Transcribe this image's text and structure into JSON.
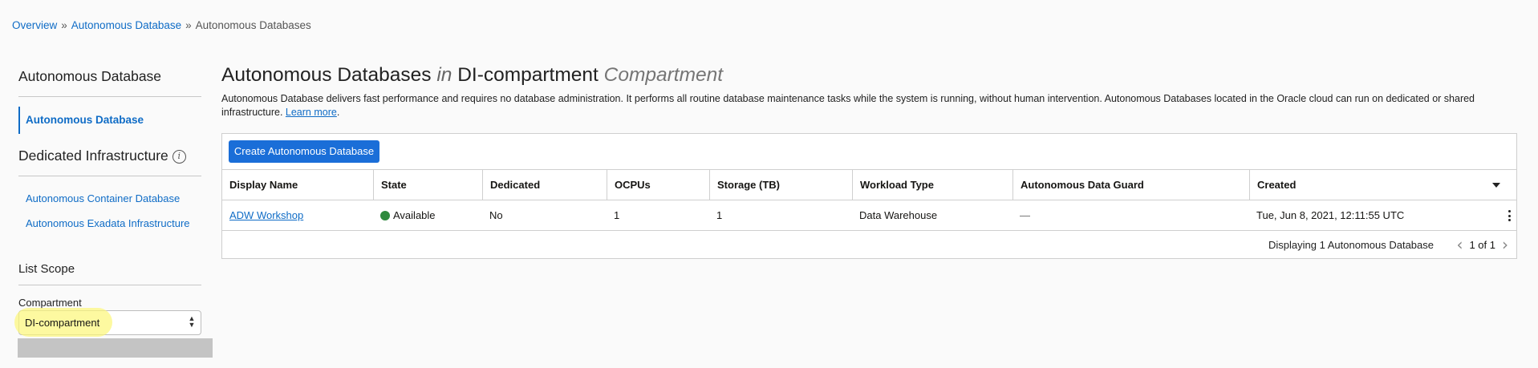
{
  "breadcrumb": {
    "items": [
      "Overview",
      "Autonomous Database",
      "Autonomous Databases"
    ],
    "separator": "»"
  },
  "sidebar": {
    "heading": "Autonomous Database",
    "active_item": "Autonomous Database",
    "dedicated_heading": "Dedicated Infrastructure",
    "info_icon": "i",
    "dedicated_links": [
      "Autonomous Container Database",
      "Autonomous Exadata Infrastructure"
    ],
    "list_scope_heading": "List Scope",
    "compartment_label": "Compartment",
    "compartment_value": "DI-compartment"
  },
  "main": {
    "title_part1": "Autonomous Databases",
    "title_in": "in",
    "title_compartment_name": "DI-compartment",
    "title_compartment_word": "Compartment",
    "description": "Autonomous Database delivers fast performance and requires no database administration. It performs all routine database maintenance tasks while the system is running, without human intervention. Autonomous Databases located in the Oracle cloud can run on dedicated or shared infrastructure.",
    "learn_more": "Learn more",
    "learn_more_suffix": ".",
    "create_button": "Create Autonomous Database"
  },
  "table": {
    "columns": [
      "Display Name",
      "State",
      "Dedicated",
      "OCPUs",
      "Storage (TB)",
      "Workload Type",
      "Autonomous Data Guard",
      "Created"
    ],
    "rows": [
      {
        "display_name": "ADW Workshop",
        "state": "Available",
        "dedicated": "No",
        "ocpus": "1",
        "storage": "1",
        "workload_type": "Data Warehouse",
        "data_guard": "—",
        "created": "Tue, Jun 8, 2021, 12:11:55 UTC"
      }
    ],
    "footer_text": "Displaying 1 Autonomous Database",
    "pager_text": "1 of 1"
  },
  "colors": {
    "link": "#0f6cc6",
    "primary_button": "#1a6ed8",
    "status_available": "#2f8a3e",
    "highlight": "#fcf778"
  }
}
